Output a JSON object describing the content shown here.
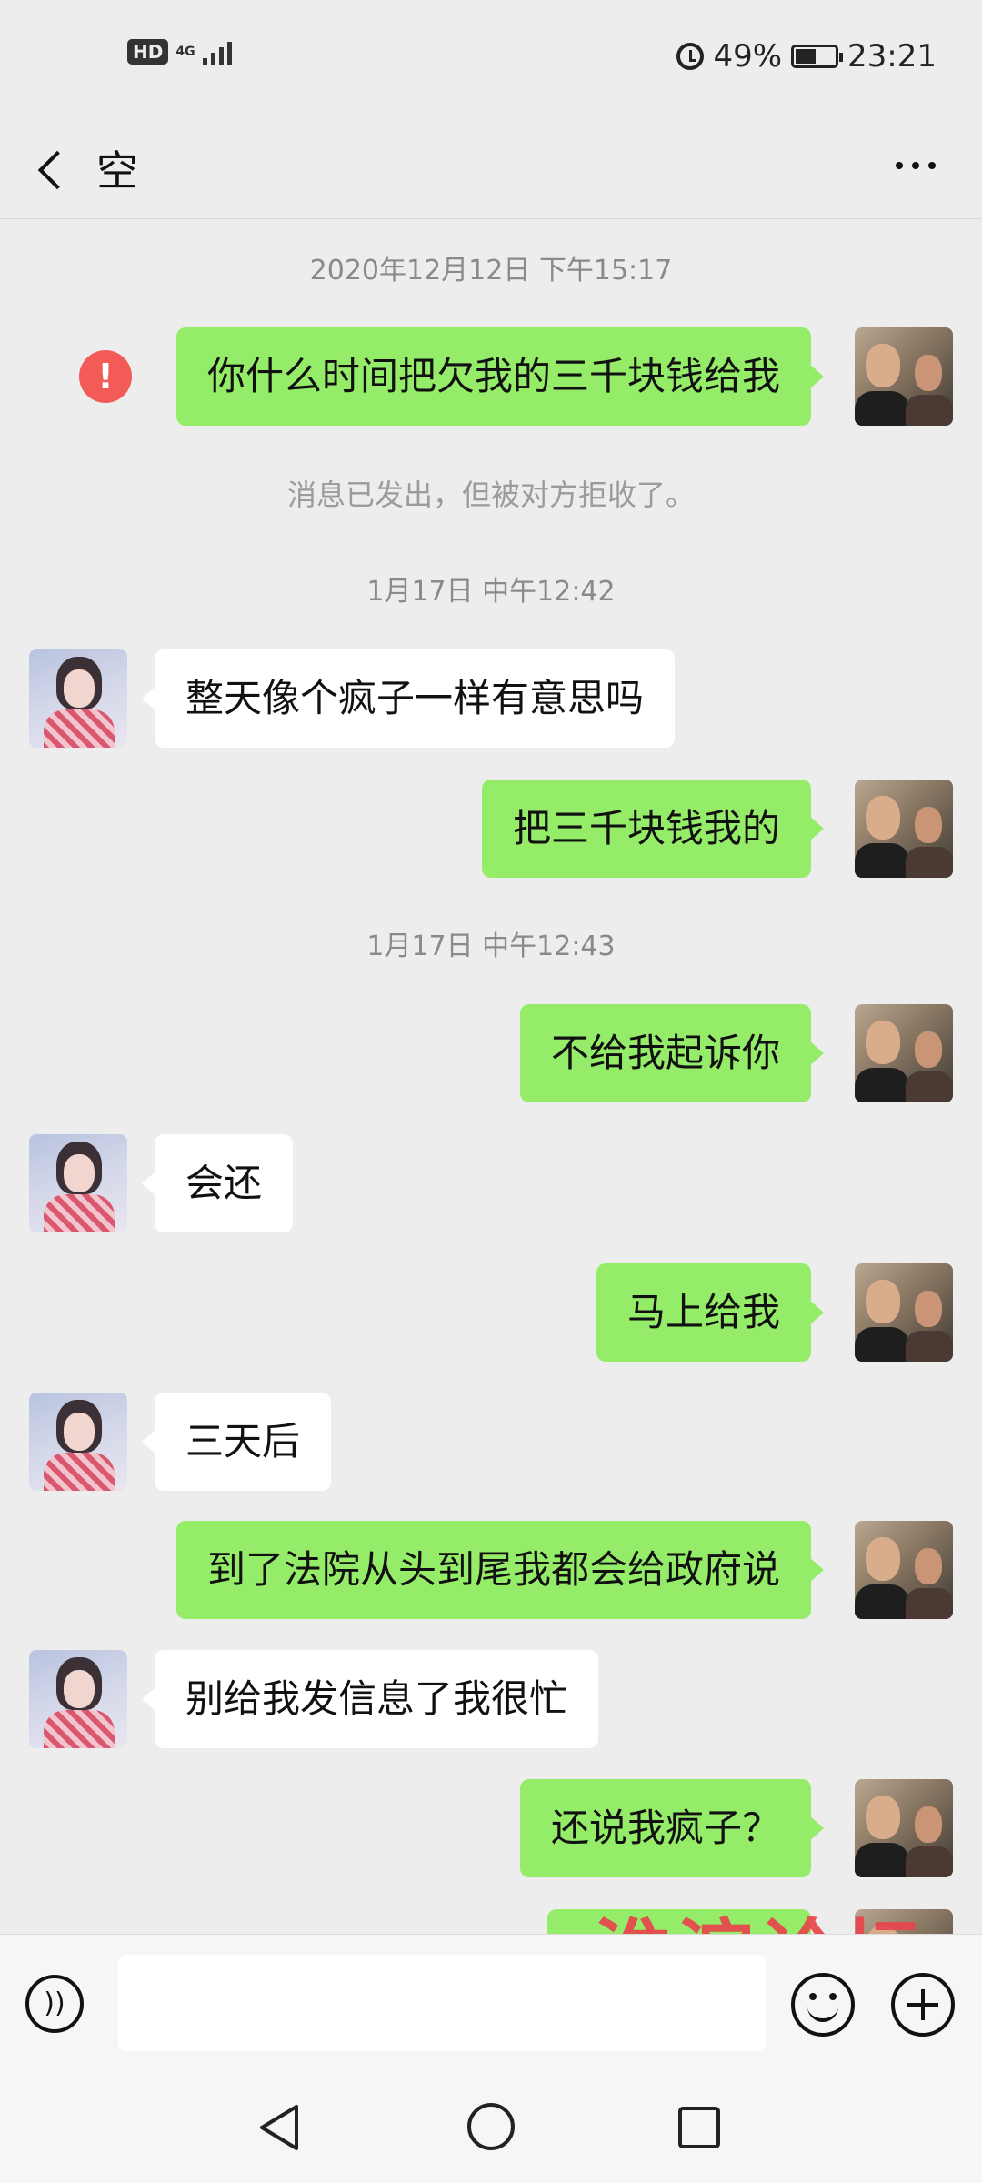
{
  "status_bar": {
    "hd": "HD",
    "network": "4G",
    "battery": "49%",
    "time": "23:21"
  },
  "header": {
    "title": "空"
  },
  "messages": [
    {
      "type": "timestamp",
      "text": "2020年12月12日 下午15:17"
    },
    {
      "type": "out",
      "text": "你什么时间把欠我的三千块钱给我",
      "error": "!"
    },
    {
      "type": "system",
      "text": "消息已发出，但被对方拒收了。"
    },
    {
      "type": "timestamp",
      "text": "1月17日 中午12:42"
    },
    {
      "type": "in",
      "text": "整天像个疯子一样有意思吗"
    },
    {
      "type": "out",
      "text": "把三千块钱我的"
    },
    {
      "type": "timestamp",
      "text": "1月17日 中午12:43"
    },
    {
      "type": "out",
      "text": "不给我起诉你"
    },
    {
      "type": "in",
      "text": "会还"
    },
    {
      "type": "out",
      "text": "马上给我"
    },
    {
      "type": "in",
      "text": "三天后"
    },
    {
      "type": "out",
      "text": "到了法院从头到尾我都会给政府说"
    },
    {
      "type": "in",
      "text": "别给我发信息了我很忙"
    },
    {
      "type": "out",
      "text": "还说我疯子？"
    }
  ],
  "watermark": "淮滨论坛",
  "input": {
    "placeholder": ""
  },
  "icons": [
    "back-arrow-icon",
    "more-icon",
    "voice-icon",
    "emoji-icon",
    "plus-icon",
    "nav-back-icon",
    "nav-home-icon",
    "nav-recent-icon"
  ]
}
